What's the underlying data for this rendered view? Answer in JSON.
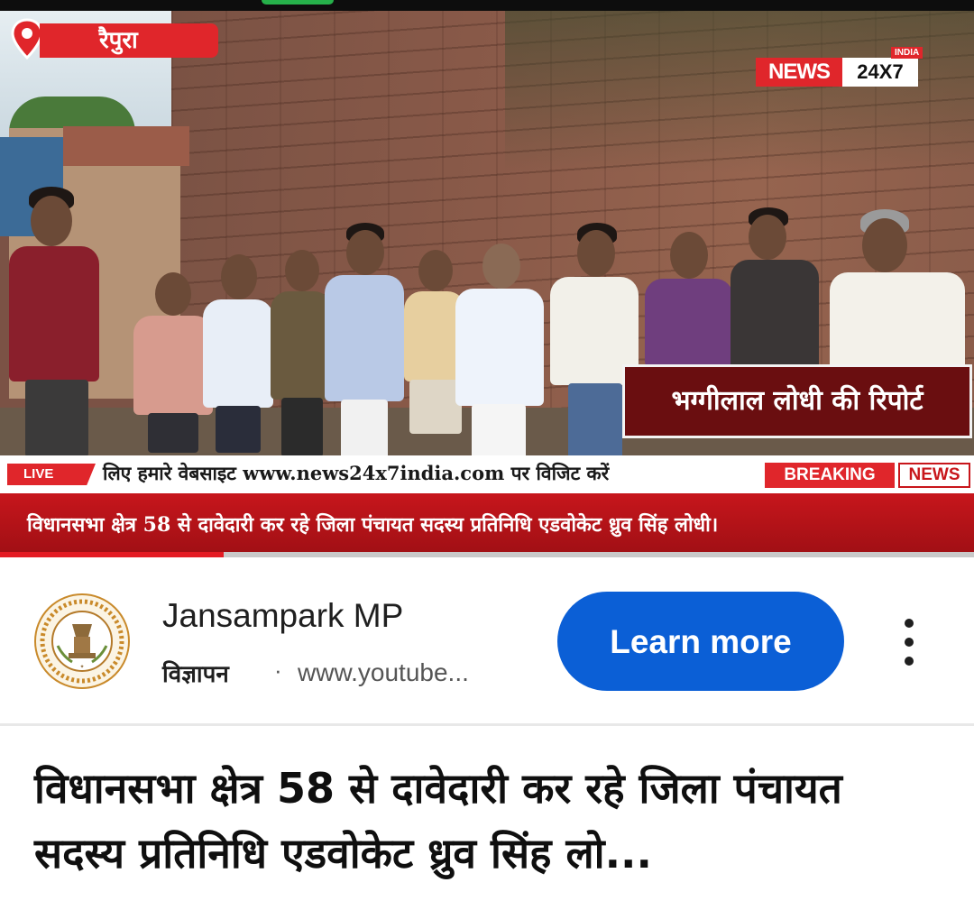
{
  "status_bar": {
    "indicator_color": "#26b04a"
  },
  "video": {
    "location_tag": "रैपुरा",
    "channel_brand": {
      "name": "NEWS",
      "suffix": "24X7",
      "region": "INDIA"
    },
    "reporter_banner": "भग्गीलाल लोधी की रिपोर्ट",
    "live_badge": "LIVE",
    "ticker_text": "लिए हमारे वेबसाइट www.news24x7india.com पर विजिट करें",
    "breaking_label": "BREAKING",
    "news_label": "NEWS",
    "headline_bar": "विधानसभा क्षेत्र 58 से दावेदारी कर रहे जिला पंचायत सदस्य प्रतिनिधि एडवोकेट ध्रुव सिंह लोधी।",
    "progress_fraction": 0.23,
    "accent_color": "#e0262b"
  },
  "ad": {
    "advertiser": "Jansampark MP",
    "label": "विज्ञापन",
    "separator": "·",
    "url": "www.youtube...",
    "cta_label": "Learn more",
    "cta_color": "#0b5fd6",
    "logo_icon": "mp-government-emblem-icon",
    "menu_icon": "more-vertical-icon"
  },
  "video_title": "विधानसभा क्षेत्र 58 से दावेदारी कर रहे जिला पंचायत सदस्य प्रतिनिधि एडवोकेट ध्रुव सिंह लो..."
}
